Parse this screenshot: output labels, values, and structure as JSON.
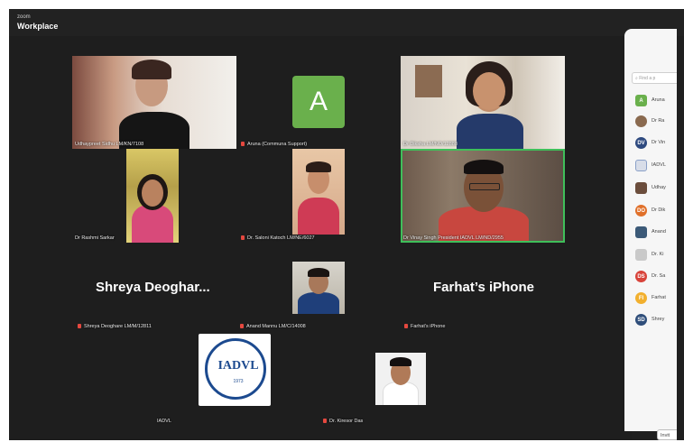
{
  "app": {
    "brand_small": "zoom",
    "brand_main": "Workplace"
  },
  "participants": {
    "udhaypreet": "Udhaypreet Sidhu LM/KN/7108",
    "aruna": "Aruna (Communa Support)",
    "aruna_initial": "A",
    "diksha": "Dr Diksha LM/NO/12888",
    "rashmi": "Dr Rashmi Sarkar",
    "saloni": "Dr. Saloni Katoch LM/NE/6027",
    "vinay": "Dr Vinay Singh President IADVL LM/ND/2955",
    "shreya_big": "Shreya  Deoghar...",
    "shreya": "Shreya Deoghare LM/M/12811",
    "anand": "Anand Mannu LM/C/14008",
    "farhat_big": "Farhat’s iPhone",
    "farhat": "Farhat’s iPhone",
    "iadvl": "IADVL",
    "iadvl_logo_text": "IADVL",
    "iadvl_logo_year": "1973",
    "kiresor": "Dr. Kiresor Das"
  },
  "panel": {
    "search_placeholder": "Find a p",
    "items": [
      {
        "initials": "A",
        "name": "Aruna",
        "color": "#6ab04c"
      },
      {
        "initials": "",
        "name": "Dr Ra",
        "color": "#8a6a4f"
      },
      {
        "initials": "DV",
        "name": "Dr Vin",
        "color": "#2e4a7f"
      },
      {
        "initials": "",
        "name": "IADVL",
        "color": "#d8dde8"
      },
      {
        "initials": "",
        "name": "Udhay",
        "color": "#6b4d3c"
      },
      {
        "initials": "DO",
        "name": "Dr Dik",
        "color": "#e0702a"
      },
      {
        "initials": "",
        "name": "Anand",
        "color": "#3c5a78"
      },
      {
        "initials": "",
        "name": "Dr. Ki",
        "color": "#c9c9c9"
      },
      {
        "initials": "DS",
        "name": "Dr. Sa",
        "color": "#d8433a"
      },
      {
        "initials": "FI",
        "name": "Farhat",
        "color": "#f2b02e"
      },
      {
        "initials": "SD",
        "name": "Shrey",
        "color": "#2f4e7a"
      }
    ],
    "invite": "Invit"
  }
}
